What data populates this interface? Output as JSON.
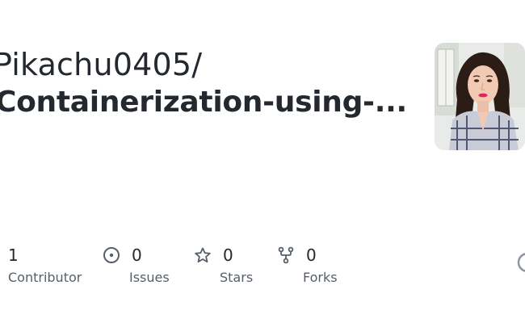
{
  "repo": {
    "owner": "Pikachu0405/",
    "name": "Containerization-using-..."
  },
  "avatar": {
    "alt": "owner avatar"
  },
  "stats": [
    {
      "icon": "people-icon",
      "value": "1",
      "label": "Contributor"
    },
    {
      "icon": "issue-icon",
      "value": "0",
      "label": "Issues"
    },
    {
      "icon": "star-icon",
      "value": "0",
      "label": "Stars"
    },
    {
      "icon": "fork-icon",
      "value": "0",
      "label": "Forks"
    }
  ],
  "colors": {
    "text": "#24292f",
    "muted": "#57606a",
    "icon": "#57606a"
  }
}
